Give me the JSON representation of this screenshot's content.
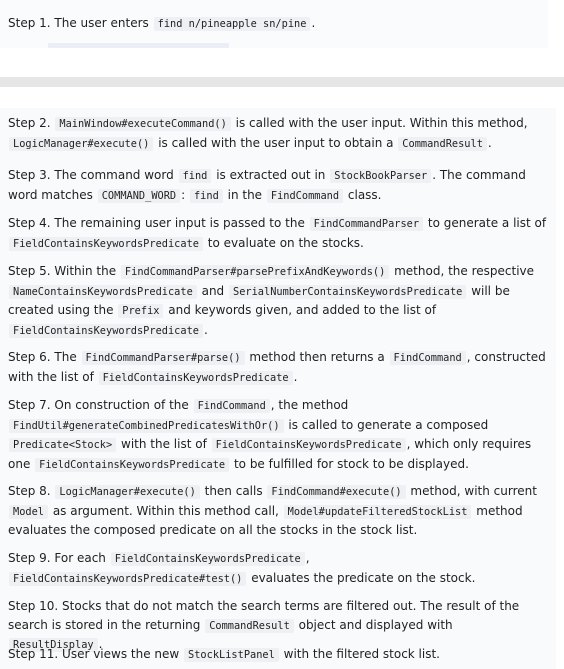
{
  "top_step": {
    "label": "Step 1.",
    "text": "The user enters",
    "code": "find n/pineapple sn/pine",
    "end": "."
  },
  "steps": [
    {
      "segments": [
        {
          "t": "Step 2. "
        },
        {
          "c": "MainWindow#executeCommand()"
        },
        {
          "t": " is called with the user input. Within this method, "
        },
        {
          "c": "LogicManager#execute()"
        },
        {
          "t": " is called with the user input to obtain a "
        },
        {
          "c": "CommandResult"
        },
        {
          "t": "."
        }
      ]
    },
    {
      "segments": [
        {
          "t": "Step 3. The command word "
        },
        {
          "c": "find"
        },
        {
          "t": " is extracted out in "
        },
        {
          "c": "StockBookParser"
        },
        {
          "t": ". The command word matches "
        },
        {
          "c": "COMMAND_WORD"
        },
        {
          "t": ": "
        },
        {
          "c": "find"
        },
        {
          "t": " in the "
        },
        {
          "c": "FindCommand"
        },
        {
          "t": " class."
        }
      ]
    },
    {
      "segments": [
        {
          "t": "Step 4. The remaining user input is passed to the "
        },
        {
          "c": "FindCommandParser"
        },
        {
          "t": " to generate a list of "
        },
        {
          "c": "FieldContainsKeywordsPredicate"
        },
        {
          "t": " to evaluate on the stocks."
        }
      ]
    },
    {
      "segments": [
        {
          "t": "Step 5. Within the "
        },
        {
          "c": "FindCommandParser#parsePrefixAndKeywords()"
        },
        {
          "t": " method, the respective "
        },
        {
          "c": "NameContainsKeywordsPredicate"
        },
        {
          "t": " and "
        },
        {
          "c": "SerialNumberContainsKeywordsPredicate"
        },
        {
          "t": " will be created using the "
        },
        {
          "c": "Prefix"
        },
        {
          "t": " and keywords given, and added to the list of "
        },
        {
          "c": "FieldContainsKeywordsPredicate"
        },
        {
          "t": "."
        }
      ]
    },
    {
      "segments": [
        {
          "t": "Step 6. The "
        },
        {
          "c": "FindCommandParser#parse()"
        },
        {
          "t": " method then returns a "
        },
        {
          "c": "FindCommand"
        },
        {
          "t": ", constructed with the list of "
        },
        {
          "c": "FieldContainsKeywordsPredicate"
        },
        {
          "t": "."
        }
      ]
    },
    {
      "segments": [
        {
          "t": "Step 7. On construction of the "
        },
        {
          "c": "FindCommand"
        },
        {
          "t": ", the method "
        },
        {
          "c": "FindUtil#generateCombinedPredicatesWithOr()"
        },
        {
          "t": " is called to generate a composed "
        },
        {
          "c": "Predicate<Stock>"
        },
        {
          "t": " with the list of "
        },
        {
          "c": "FieldContainsKeywordsPredicate"
        },
        {
          "t": ", which only requires one "
        },
        {
          "c": "FieldContainsKeywordsPredicate"
        },
        {
          "t": " to be fulfilled for stock to be displayed."
        }
      ]
    },
    {
      "segments": [
        {
          "t": "Step 8. "
        },
        {
          "c": "LogicManager#execute()"
        },
        {
          "t": " then calls "
        },
        {
          "c": "FindCommand#execute()"
        },
        {
          "t": " method, with current "
        },
        {
          "c": "Model"
        },
        {
          "t": " as argument. Within this method call, "
        },
        {
          "c": "Model#updateFilteredStockList"
        },
        {
          "t": " method evaluates the composed predicate on all the stocks in the stock list."
        }
      ]
    },
    {
      "segments": [
        {
          "t": "Step 9. For each "
        },
        {
          "c": "FieldContainsKeywordsPredicate"
        },
        {
          "t": ", "
        },
        {
          "c": "FieldContainsKeywordsPredicate#test()"
        },
        {
          "t": " evaluates the predicate on the stock."
        }
      ]
    },
    {
      "segments": [
        {
          "t": "Step 10. Stocks that do not match the search terms are filtered out. The result of the search is stored in the returning "
        },
        {
          "c": "CommandResult"
        },
        {
          "t": " object and displayed with "
        },
        {
          "c": "ResultDisplay"
        },
        {
          "t": "."
        }
      ]
    },
    {
      "segments": [
        {
          "t": "Step 11. User views the new "
        },
        {
          "c": "StockListPanel"
        },
        {
          "t": " with the filtered stock list."
        }
      ]
    }
  ]
}
